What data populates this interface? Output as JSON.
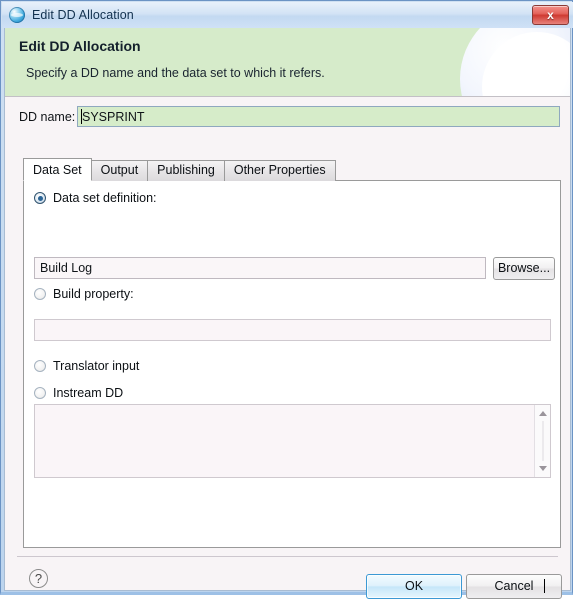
{
  "window": {
    "title": "Edit DD Allocation",
    "icon": "globe-icon",
    "close_label": "x"
  },
  "banner": {
    "title": "Edit DD Allocation",
    "description": "Specify a DD name and the data set to which it refers.",
    "background_color": "#d6ebca"
  },
  "form": {
    "dd_name_label": "DD name:",
    "dd_name_value": "SYSPRINT",
    "dd_name_placeholder": "",
    "dd_name_field_color": "#d6ecc9"
  },
  "tabs": [
    {
      "label": "Data Set",
      "active": true
    },
    {
      "label": "Output",
      "active": false
    },
    {
      "label": "Publishing",
      "active": false
    },
    {
      "label": "Other Properties",
      "active": false
    }
  ],
  "data_set_tab": {
    "options": [
      {
        "label": "Data set definition:",
        "selected": true
      },
      {
        "label": "Build property:",
        "selected": false
      },
      {
        "label": "Translator input",
        "selected": false
      },
      {
        "label": "Instream DD",
        "selected": false
      }
    ],
    "data_set_definition_value": "Build Log",
    "data_set_definition_placeholder": "",
    "browse_label": "Browse...",
    "build_property_value": "",
    "build_property_placeholder": "",
    "instream_text": ""
  },
  "footer": {
    "help_label": "?",
    "ok_label": "OK",
    "cancel_label": "Cancel",
    "accent_color": "#3c99d4"
  }
}
